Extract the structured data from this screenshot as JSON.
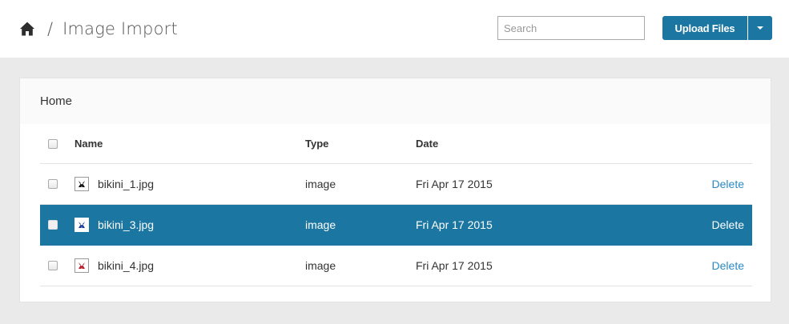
{
  "header": {
    "breadcrumb_separator": "/",
    "title": "Image Import",
    "home_icon": "home-icon"
  },
  "search": {
    "placeholder": "Search",
    "value": ""
  },
  "upload": {
    "label": "Upload Files",
    "dropdown_icon": "caret-down-icon"
  },
  "panel": {
    "title": "Home",
    "columns": {
      "name": "Name",
      "type": "Type",
      "date": "Date"
    },
    "rows": [
      {
        "name": "bikini_1.jpg",
        "type": "image",
        "date": "Fri Apr 17 2015",
        "action": "Delete",
        "selected": false,
        "thumb_color": "#111111"
      },
      {
        "name": "bikini_3.jpg",
        "type": "image",
        "date": "Fri Apr 17 2015",
        "action": "Delete",
        "selected": true,
        "thumb_color": "#1c3f9a"
      },
      {
        "name": "bikini_4.jpg",
        "type": "image",
        "date": "Fri Apr 17 2015",
        "action": "Delete",
        "selected": false,
        "thumb_color": "#b51d2a"
      }
    ]
  },
  "colors": {
    "accent": "#1b76a1",
    "link": "#2a8ac4",
    "background": "#eaeaea"
  }
}
